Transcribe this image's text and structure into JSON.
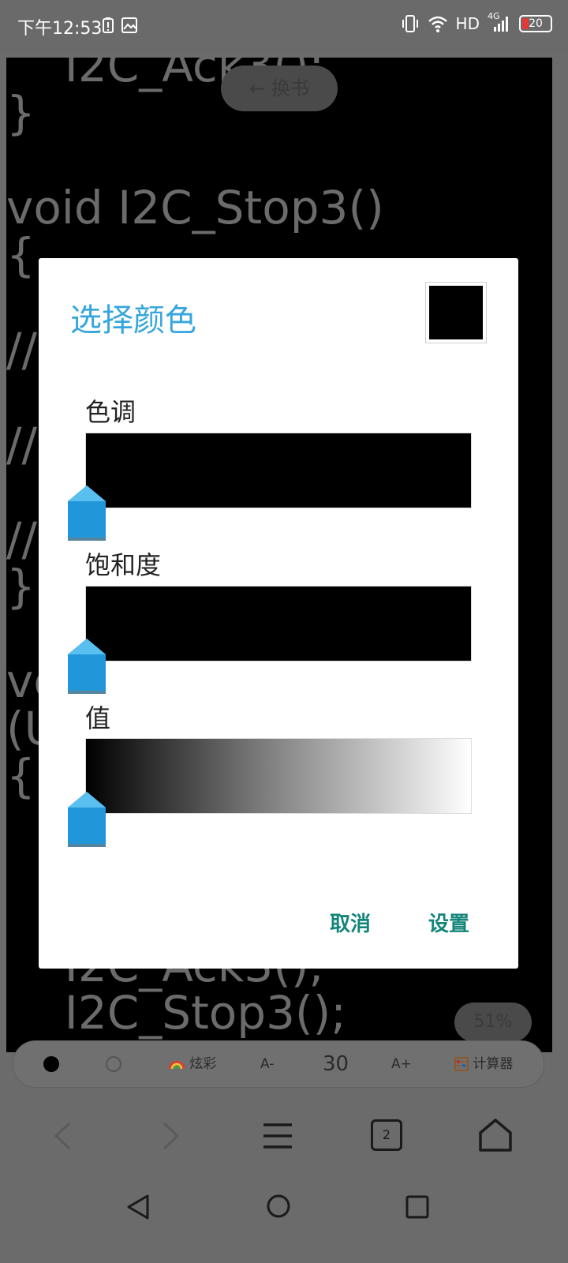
{
  "status_bar": {
    "time": "下午12:53",
    "network": "HD",
    "network_gen": "4G",
    "battery": "20"
  },
  "reader": {
    "code_lines": [
      "    I2C_Ack3();",
      "}",
      "",
      "void I2C_Stop3()",
      "{",
      "",
      "//",
      "",
      "//",
      "",
      "//",
      "}",
      "",
      "vo",
      "(U",
      "{",
      "",
      "",
      "",
      "    I2C_Ack3();",
      "    I2C_Stop3();"
    ],
    "change_book": "← 换书",
    "progress": "51%"
  },
  "dialog": {
    "title": "选择颜色",
    "preview_color": "#000000",
    "sliders": [
      {
        "label": "色调",
        "value": 0
      },
      {
        "label": "饱和度",
        "value": 0
      },
      {
        "label": "值",
        "value": 0
      }
    ],
    "cancel": "取消",
    "confirm": "设置",
    "colors": {
      "title": "#36a6dc",
      "button": "#13857a",
      "thumb": "#2196d9"
    }
  },
  "toolbar": {
    "colorful": "炫彩",
    "font_decrease": "A-",
    "font_size": "30",
    "font_increase": "A+",
    "calculator": "计算器"
  },
  "browser_nav": {
    "tab_count": "2"
  }
}
